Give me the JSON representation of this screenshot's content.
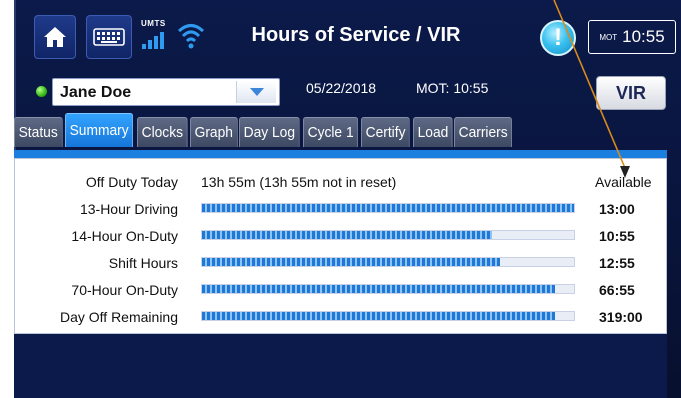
{
  "header": {
    "title": "Hours of Service / VIR",
    "network": "UMTS",
    "clock": {
      "prefix": "MOT",
      "time": "10:55"
    }
  },
  "driver_bar": {
    "driver_name": "Jane Doe",
    "date": "05/22/2018",
    "mot_time": "MOT: 10:55",
    "vir_label": "VIR",
    "status_color": "#3bbd1a"
  },
  "tabs": [
    {
      "label": "Status",
      "active": false
    },
    {
      "label": "Summary",
      "active": true
    },
    {
      "label": "Clocks",
      "active": false
    },
    {
      "label": "Graph",
      "active": false
    },
    {
      "label": "Day Log",
      "active": false
    },
    {
      "label": "Cycle 1",
      "active": false
    },
    {
      "label": "Certify",
      "active": false
    },
    {
      "label": "Load",
      "active": false
    },
    {
      "label": "Carriers",
      "active": false
    }
  ],
  "summary": {
    "off_duty_label": "Off Duty Today",
    "off_duty_value": "13h 55m (13h 55m not in reset)",
    "available_header": "Available",
    "rows": [
      {
        "label": "13-Hour Driving",
        "available": "13:00",
        "fill_fraction": 1.0
      },
      {
        "label": "14-Hour On-Duty",
        "available": "10:55",
        "fill_fraction": 0.78
      },
      {
        "label": "Shift Hours",
        "available": "12:55",
        "fill_fraction": 0.8
      },
      {
        "label": "70-Hour On-Duty",
        "available": "66:55",
        "fill_fraction": 0.95
      },
      {
        "label": "Day Off Remaining",
        "available": "319:00",
        "fill_fraction": 0.95
      }
    ]
  },
  "icons": {
    "home": "home-icon",
    "keyboard": "keyboard-icon",
    "signal": "cell-signal-icon",
    "wifi": "wifi-icon",
    "alert": "alert-icon",
    "dropdown": "chevron-down-icon"
  },
  "colors": {
    "accent": "#1b7fe0",
    "header_bg": "#0b1a4a",
    "alert": "#39c0ef",
    "annotation_arrow": "#d98a1a"
  }
}
